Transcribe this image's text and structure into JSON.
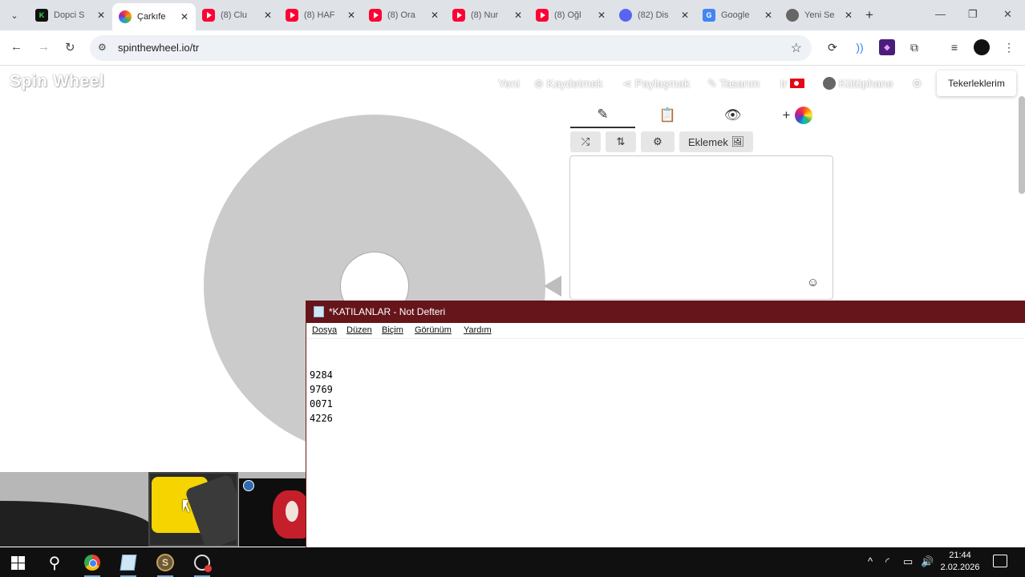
{
  "browser": {
    "tabs": [
      {
        "title": "Dopci S",
        "icon": "k-icon",
        "color": "#1a8a1a"
      },
      {
        "title": "Çarkıfe",
        "icon": "spinwheel-icon",
        "active": true
      },
      {
        "title": "(8) Clu",
        "icon": "youtube-icon"
      },
      {
        "title": "(8) HAF",
        "icon": "youtube-icon"
      },
      {
        "title": "(8) Ora",
        "icon": "youtube-icon"
      },
      {
        "title": "(8) Nur",
        "icon": "youtube-icon"
      },
      {
        "title": "(8) Oğl",
        "icon": "youtube-icon"
      },
      {
        "title": "(82) Dis",
        "icon": "discord-icon"
      },
      {
        "title": "Google",
        "icon": "google-translate-icon"
      },
      {
        "title": "Yeni Se",
        "icon": "chrome-icon"
      }
    ],
    "url": "spinthewheel.io/tr"
  },
  "site": {
    "logo": "Spin Wheel",
    "nav": {
      "new": "Yeni",
      "save": "Kaydetmek",
      "share": "Paylaşmak",
      "design": "Tasarım",
      "lang": "tr",
      "library": "Kütüphane"
    },
    "my_wheels": "Tekerleklerim",
    "add_button": "Eklemek"
  },
  "notepad": {
    "title": "*KATILANLAR - Not Defteri",
    "menu": [
      "Dosya",
      "Düzen",
      "Biçim",
      "Görünüm",
      "Yardım"
    ],
    "lines": [
      "9284",
      "9769",
      "0071",
      "4226"
    ]
  },
  "taskbar": {
    "time": "21:44",
    "date": "2.02.2026"
  },
  "colors": {
    "notepad_titlebar": "#66151a",
    "wheel": "#cbcbcb",
    "taskbar": "#101010"
  }
}
